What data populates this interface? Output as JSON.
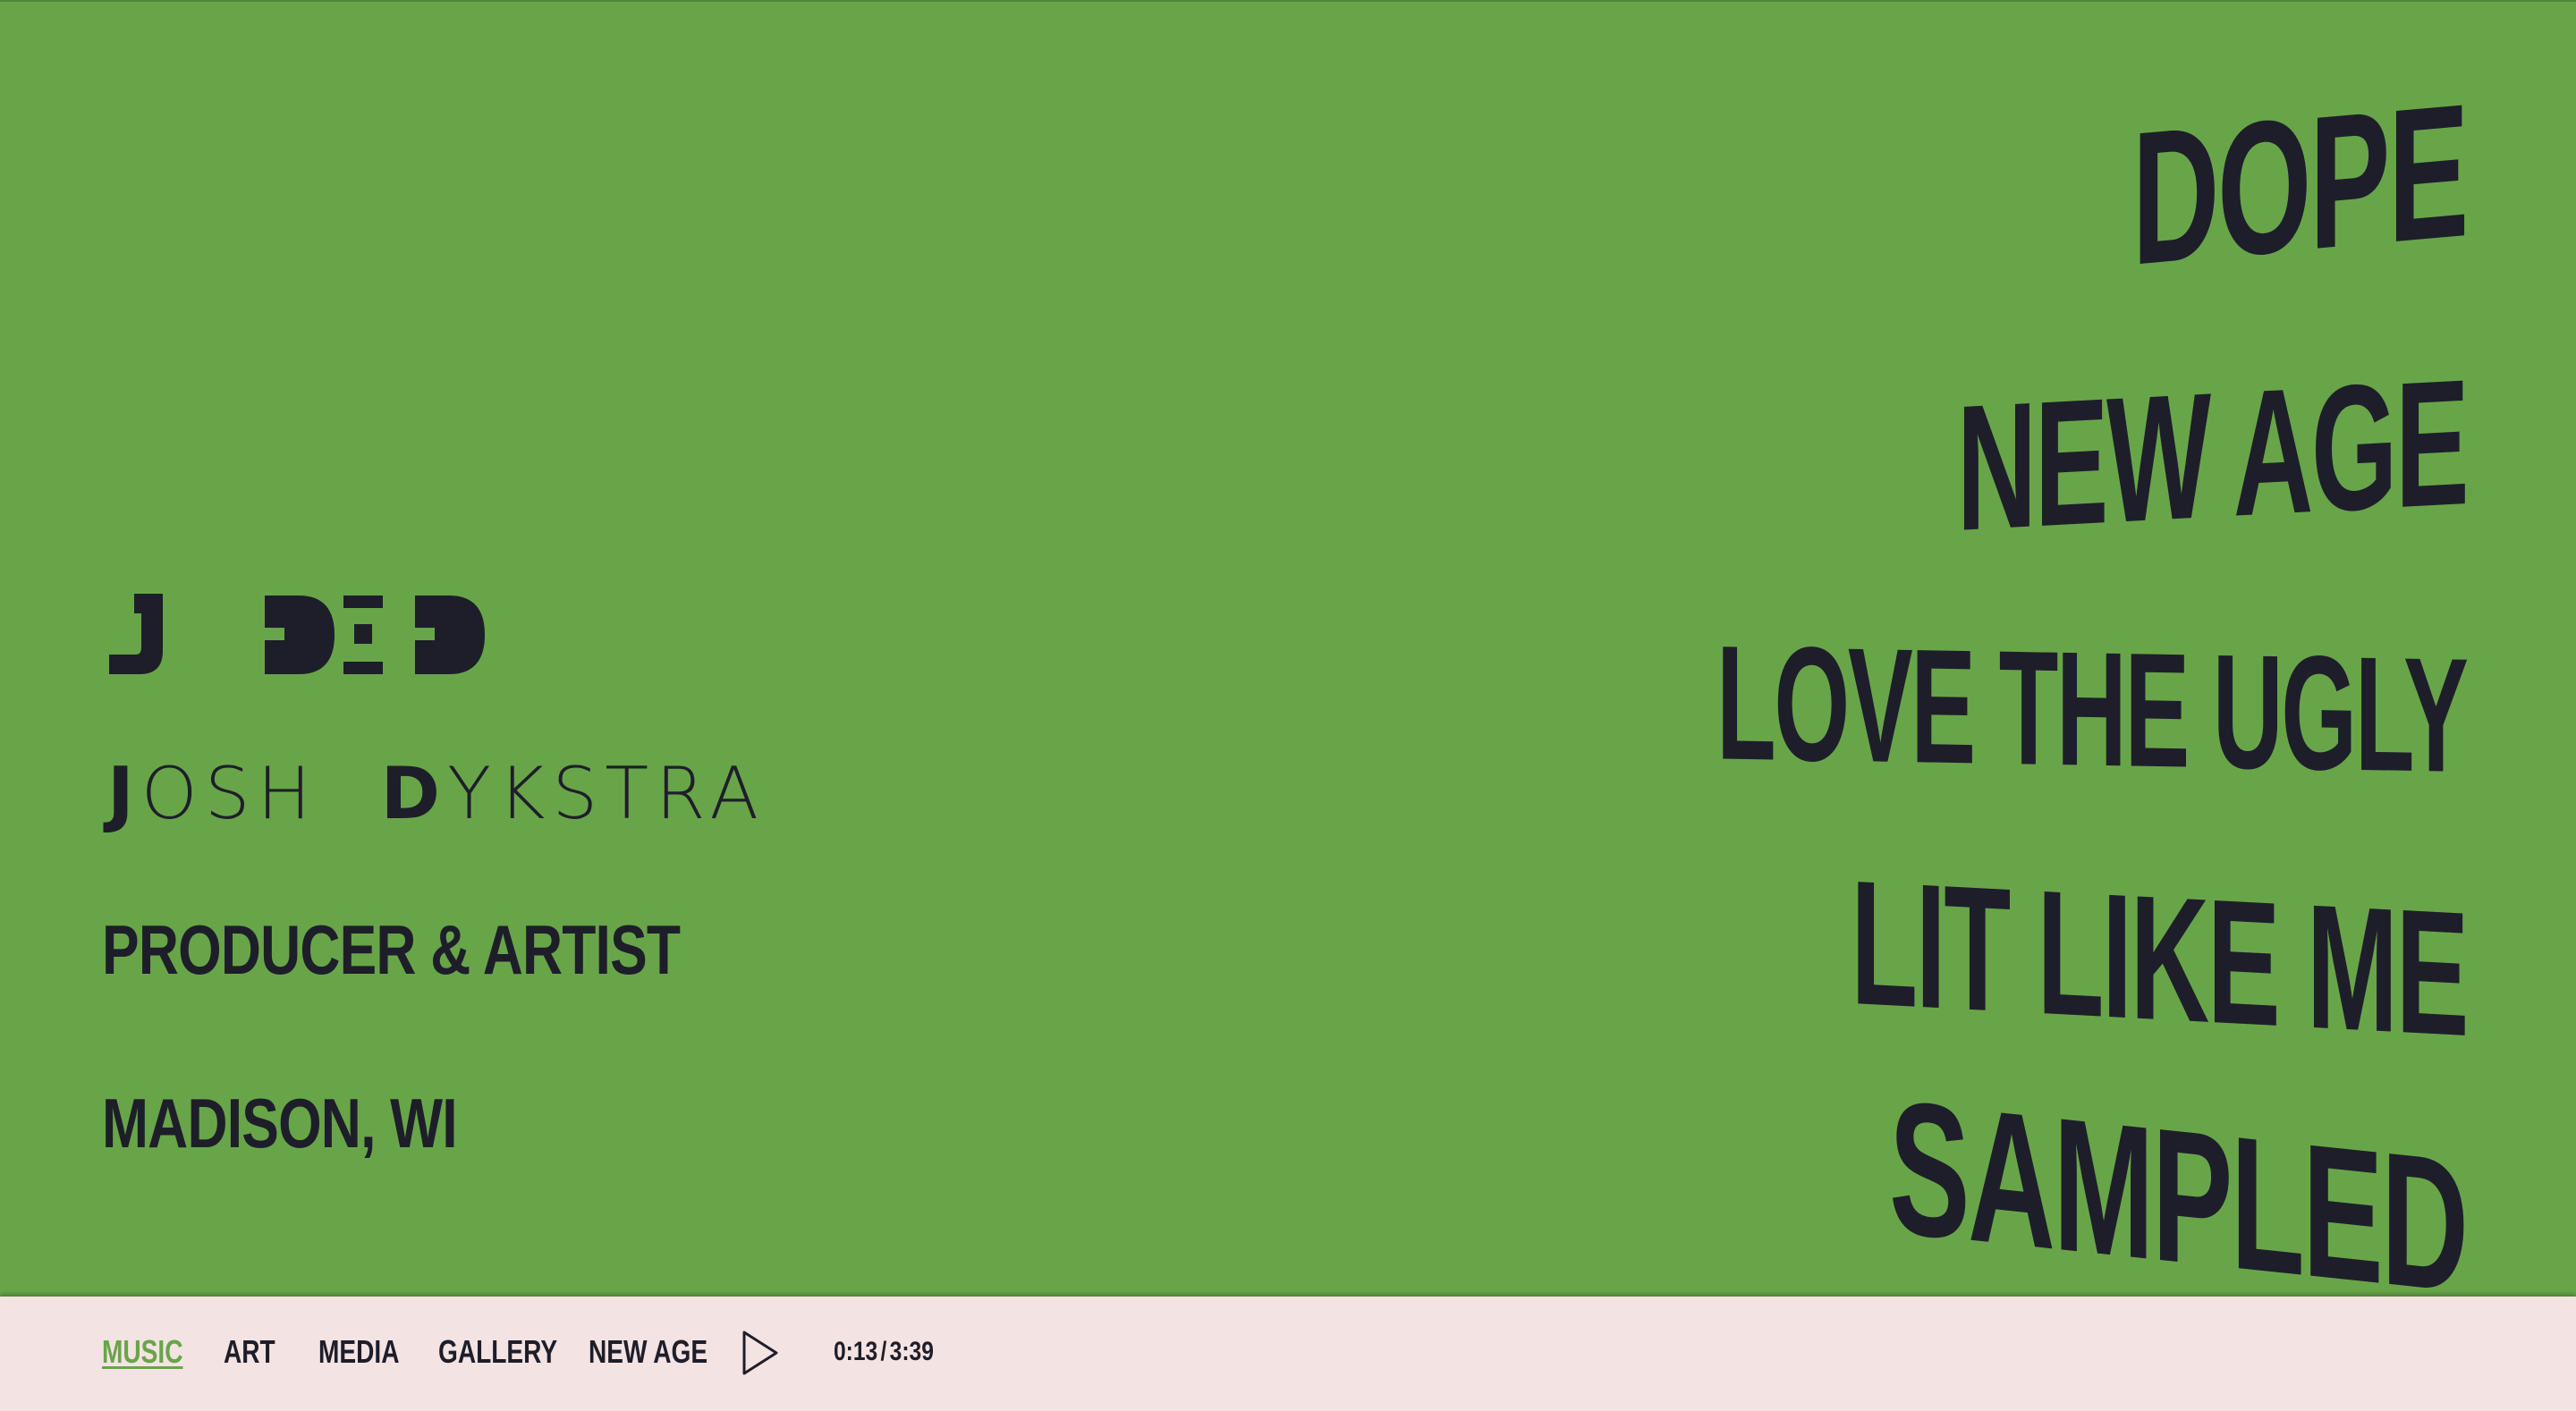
{
  "brand": {
    "logo_text": "J DID",
    "full_name": {
      "first": "JOSH",
      "last": "DYKSTRA"
    },
    "tagline": "PRODUCER & ARTIST",
    "location": "MADISON, WI"
  },
  "songs": [
    {
      "title": "DOPE"
    },
    {
      "title": "NEW AGE"
    },
    {
      "title": "LOVE THE UGLY"
    },
    {
      "title": "LIT LIKE ME"
    },
    {
      "title": "SAMPLED"
    }
  ],
  "nav": {
    "items": [
      {
        "label": "MUSIC",
        "active": true
      },
      {
        "label": "ART",
        "active": false
      },
      {
        "label": "MEDIA",
        "active": false
      },
      {
        "label": "GALLERY",
        "active": false
      }
    ]
  },
  "player": {
    "track_title": "NEW AGE",
    "current_time": "0:13",
    "separator": "/",
    "duration": "3:39",
    "play_icon": "play-icon"
  },
  "colors": {
    "background": "#68a549",
    "bar_background": "#f3e3e2",
    "text": "#1e1e2a",
    "accent": "#68a549"
  }
}
